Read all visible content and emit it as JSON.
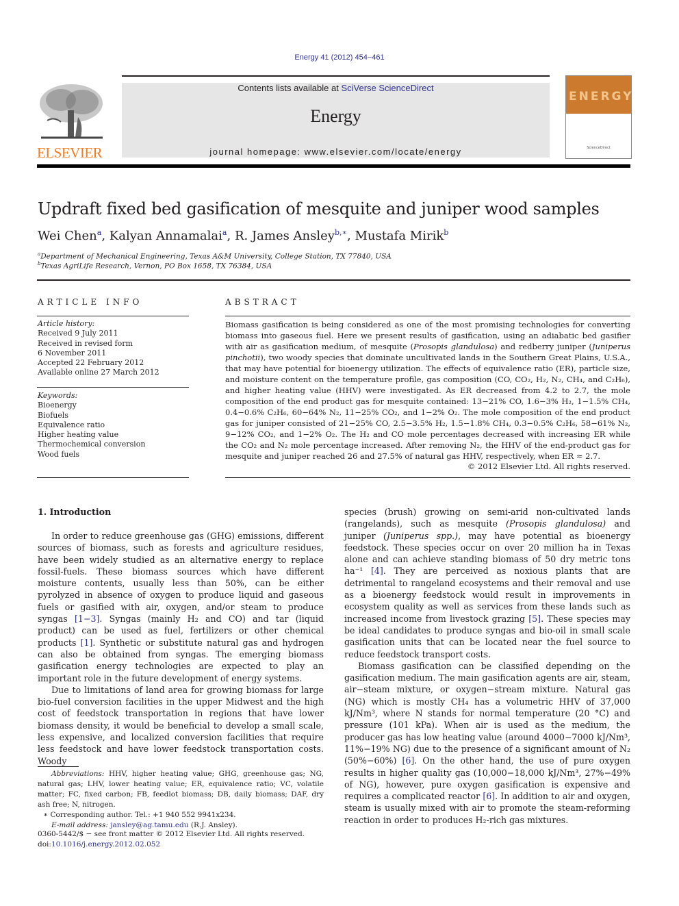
{
  "header": {
    "citation": "Energy 41 (2012) 454−461",
    "contents_prefix": "Contents lists available at ",
    "contents_link": "SciVerse ScienceDirect",
    "journal_name": "Energy",
    "homepage": "journal homepage: www.elsevier.com/locate/energy",
    "publisher_logo_text": "ELSEVIER",
    "cover_title": "ENERGY",
    "colors": {
      "publisher_orange": "#f47b20",
      "banner_gray": "#e6e6e6",
      "link_blue": "#2e3192",
      "cover_orange": "#cc7a2e"
    }
  },
  "article": {
    "title": "Updraft fixed bed gasification of mesquite and juniper wood samples",
    "authors": [
      {
        "name": "Wei Chen",
        "aff": "a"
      },
      {
        "name": "Kalyan Annamalai",
        "aff": "a"
      },
      {
        "name": "R. James Ansley",
        "aff": "b,∗"
      },
      {
        "name": "Mustafa Mirik",
        "aff": "b"
      }
    ],
    "affiliations": [
      {
        "key": "a",
        "text": "Department of Mechanical Engineering, Texas A&M University, College Station, TX 77840, USA"
      },
      {
        "key": "b",
        "text": "Texas AgriLife Research, Vernon, PO Box 1658, TX 76384, USA"
      }
    ]
  },
  "article_info": {
    "heading": "ARTICLE INFO",
    "history_label": "Article history:",
    "history": [
      "Received 9 July 2011",
      "Received in revised form",
      "6 November 2011",
      "Accepted 22 February 2012",
      "Available online 27 March 2012"
    ],
    "keywords_label": "Keywords:",
    "keywords": [
      "Bioenergy",
      "Biofuels",
      "Equivalence ratio",
      "Higher heating value",
      "Thermochemical conversion",
      "Wood fuels"
    ]
  },
  "abstract": {
    "heading": "ABSTRACT",
    "p1": "Biomass gasification is being considered as one of the most promising technologies for converting biomass into gaseous fuel. Here we present results of gasification, using an adiabatic bed gasifier with air as gasification medium, of mesquite (",
    "sp1": "Prosopis glandulosa",
    "p2": ") and redberry juniper (",
    "sp2": "Juniperus pinchotii",
    "p3": "), two woody species that dominate uncultivated lands in the Southern Great Plains, U.S.A., that may have potential for bioenergy utilization. The effects of equivalence ratio (ER), particle size, and moisture content on the temperature profile, gas composition (CO, CO₂, H₂, N₂, CH₄, and C₂H₆), and higher heating value (HHV) were investigated. As ER decreased from 4.2 to 2.7, the mole composition of the end product gas for mesquite contained: 13−21% CO, 1.6−3% H₂, 1−1.5% CH₄, 0.4−0.6% C₂H₆, 60−64% N₂, 11−25% CO₂, and 1−2% O₂. The mole composition of the end product gas for juniper consisted of 21−25% CO, 2.5−3.5% H₂, 1.5−1.8% CH₄, 0.3−0.5% C₂H₆, 58−61% N₂, 9−12% CO₂, and 1−2% O₂. The H₂ and CO mole percentages decreased with increasing ER while the CO₂ and N₂ mole percentage increased. After removing N₂, the HHV of the end-product gas for mesquite and juniper reached 26 and 27.5% of natural gas HHV, respectively, when ER ≈ 2.7.",
    "copyright": "© 2012 Elsevier Ltd. All rights reserved."
  },
  "intro": {
    "heading": "1.  Introduction",
    "left_p1_a": "In order to reduce greenhouse gas (GHG) emissions, different sources of biomass, such as forests and agriculture residues, have been widely studied as an alternative energy to replace fossil-fuels. These biomass sources which have different moisture contents, usually less than 50%, can be either pyrolyzed in absence of oxygen to produce liquid and gaseous fuels or gasified with air, oxygen, and/or steam to produce syngas ",
    "ref_1_3": "[1−3]",
    "left_p1_b": ". Syngas (mainly H₂ and CO) and tar (liquid product) can be used as fuel, fertilizers or other chemical products ",
    "ref_1": "[1]",
    "left_p1_c": ". Synthetic or substitute natural gas and hydrogen can also be obtained from syngas. The emerging biomass gasification energy technologies are expected to play an important role in the future development of energy systems.",
    "left_p2": "Due to limitations of land area for growing biomass for large bio-fuel conversion facilities in the upper Midwest and the high cost of feedstock transportation in regions that have lower biomass density, it would be beneficial to develop a small scale, less expensive, and localized conversion facilities that require less feedstock and have lower feedstock transportation costs. Woody",
    "right_p1_a": "species (brush) growing on semi-arid non-cultivated lands (rangelands), such as mesquite ",
    "right_sp1": "(Prosopis glandulosa)",
    "right_p1_b": " and juniper ",
    "right_sp2": "(Juniperus spp.)",
    "right_p1_c": ", may have potential as bioenergy feedstock. These species occur on over 20 million ha in Texas alone and can achieve standing biomass of 50 dry metric tons ha⁻¹ ",
    "ref_4": "[4]",
    "right_p1_d": ". They are perceived as noxious plants that are detrimental to rangeland ecosystems and their removal and use as a bioenergy feedstock would result in improvements in ecosystem quality as well as services from these lands such as increased income from livestock grazing ",
    "ref_5": "[5]",
    "right_p1_e": ". These species may be ideal candidates to produce syngas and bio-oil in small scale gasification units that can be located near the fuel source to reduce feedstock transport costs.",
    "right_p2_a": "Biomass gasification can be classified depending on the gasification medium. The main gasification agents are air, steam, air−steam mixture, or oxygen−stream mixture. Natural gas (NG) which is mostly CH₄ has a volumetric HHV of 37,000 kJ/Nm³, where N stands for normal temperature (20 °C) and pressure (101 kPa). When air is used as the medium, the producer gas has low heating value (around 4000−7000 kJ/Nm³, 11%−19% NG) due to the presence of a significant amount of N₂ (50%−60%) ",
    "ref_6a": "[6]",
    "right_p2_b": ". On the other hand, the use of pure oxygen results in higher quality gas (10,000−18,000 kJ/Nm³, 27%−49% of NG), however, pure oxygen gasification is expensive and requires a complicated reactor ",
    "ref_6b": "[6]",
    "right_p2_c": ". In addition to air and oxygen, steam is usually mixed with air to promote the steam-reforming reaction in order to produces H₂-rich gas mixtures."
  },
  "footnotes": {
    "abbrev_label": "Abbreviations:",
    "abbrev_text": " HHV, higher heating value; GHG, greenhouse gas; NG, natural gas; LHV, lower heating value; ER, equivalence ratio; VC, volatile matter; FC, fixed carbon; FB, feedlot biomass; DB, daily biomass; DAF, dry ash free; N, nitrogen.",
    "corresponding": "∗  Corresponding author. Tel.: +1 940 552 9941x234.",
    "email_label": "E-mail address:",
    "email": "jansley@ag.tamu.edu",
    "email_suffix": " (R.J. Ansley).",
    "front_matter": "0360-5442/$ − see front matter © 2012 Elsevier Ltd. All rights reserved.",
    "doi_prefix": "doi:",
    "doi": "10.1016/j.energy.2012.02.052"
  }
}
